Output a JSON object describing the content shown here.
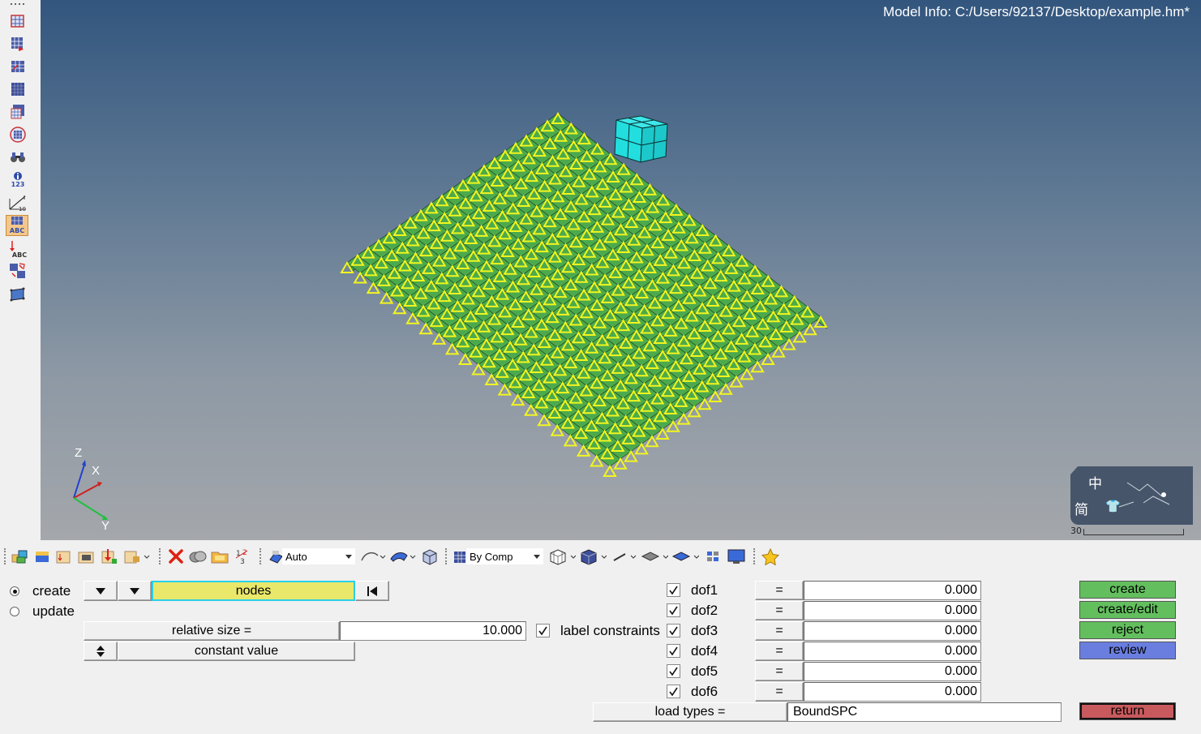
{
  "viewport": {
    "model_info": "Model Info: C:/Users/92137/Desktop/example.hm*",
    "triad": {
      "z": "Z",
      "x": "X",
      "y": "Y"
    },
    "thumbnail": {
      "char1": "中",
      "char2": "简",
      "scale_value": "30"
    },
    "colors": {
      "mesh_green": "#4caa4c",
      "constraint_yellow": "#f2f51e",
      "cube_cyan": "#22dede"
    }
  },
  "left_toolbar": {
    "icons": [
      "more-dots-icon",
      "mesh-icon",
      "mesh-red-icon",
      "mesh-split-icon",
      "mesh-blue-icon",
      "mesh-edit-icon",
      "mesh-circle-icon",
      "binoculars-icon",
      "info-icon",
      "ruler-icon",
      "label-abc-icon",
      "arrow-abc-icon",
      "transform-icon",
      "plane-icon"
    ],
    "info_text": "123",
    "ruler_text": "10",
    "abc_text": "ABC",
    "abc_text2": "ABC"
  },
  "bottom_toolbar": {
    "shade_mode": "Auto",
    "color_mode": "By Comp",
    "icons": [
      "components-icon",
      "solid-icon",
      "load-collector-icon",
      "system-icon",
      "load-icon",
      "import-icon",
      "delete-icon",
      "cylinders-icon",
      "folder-icon",
      "numbers-icon",
      "shade-icon",
      "curve-icon",
      "surface-icon",
      "cube-icon",
      "color-icon",
      "wireframe-icon",
      "shaded-elements-icon",
      "line-icon",
      "layer-icon",
      "plane-icon",
      "grid-icon",
      "monitor-icon",
      "star-icon"
    ]
  },
  "panel": {
    "mode": {
      "create": "create",
      "update": "update",
      "selected": "create"
    },
    "selector": {
      "entity": "nodes"
    },
    "relative_size": {
      "label": "relative size =",
      "value": "10.000"
    },
    "label_constraints": {
      "label": "label constraints",
      "checked": true
    },
    "value_mode": "constant value",
    "dofs": [
      {
        "label": "dof1",
        "checked": true,
        "eq": "=",
        "value": "0.000"
      },
      {
        "label": "dof2",
        "checked": true,
        "eq": "=",
        "value": "0.000"
      },
      {
        "label": "dof3",
        "checked": true,
        "eq": "=",
        "value": "0.000"
      },
      {
        "label": "dof4",
        "checked": true,
        "eq": "=",
        "value": "0.000"
      },
      {
        "label": "dof5",
        "checked": true,
        "eq": "=",
        "value": "0.000"
      },
      {
        "label": "dof6",
        "checked": true,
        "eq": "=",
        "value": "0.000"
      }
    ],
    "load_types": {
      "label": "load types =",
      "value": "BoundSPC"
    },
    "actions": {
      "create": "create",
      "create_edit": "create/edit",
      "reject": "reject",
      "review": "review",
      "return": "return"
    },
    "colors": {
      "green": "#63bf5e",
      "blue": "#6a7ee0",
      "red": "#c85a5e",
      "selector_yellow": "#e9e86b"
    }
  }
}
